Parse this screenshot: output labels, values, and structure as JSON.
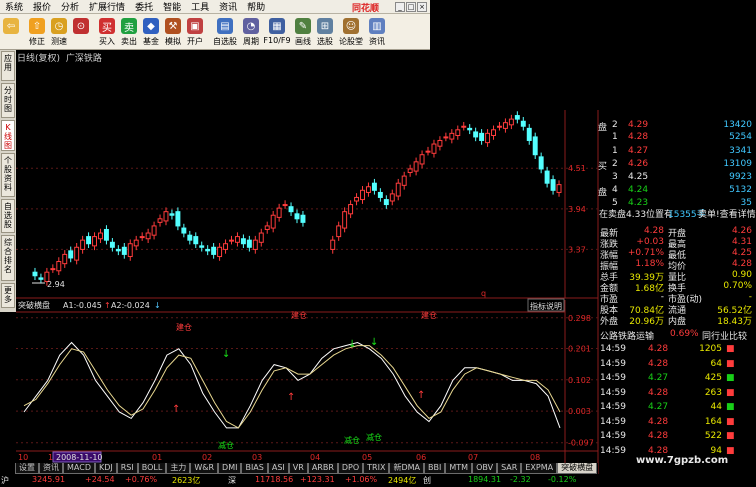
{
  "menubar": {
    "items": [
      "系统",
      "报价",
      "分析",
      "扩展行情",
      "委托",
      "智能",
      "工具",
      "资讯",
      "帮助"
    ],
    "brand": "同花顺"
  },
  "toolbar": {
    "buttons": [
      {
        "name": "back",
        "label": "",
        "icon": "back-arrow-icon",
        "color": "#e8b440"
      },
      {
        "name": "revise",
        "label": "修正",
        "icon": "up-arrow-icon",
        "color": "#f0a020"
      },
      {
        "name": "estimate",
        "label": "测速",
        "icon": "clock-icon",
        "color": "#d9a020"
      },
      {
        "name": "timer",
        "label": "",
        "icon": "timer-icon",
        "color": "#c03030"
      },
      {
        "name": "buy",
        "label": "买入",
        "icon": "buy-icon",
        "color": "#d03030"
      },
      {
        "name": "sell",
        "label": "卖出",
        "icon": "sell-icon",
        "color": "#20a040"
      },
      {
        "name": "fund",
        "label": "基金",
        "icon": "fund-icon",
        "color": "#3060c0"
      },
      {
        "name": "simulate",
        "label": "模拟",
        "icon": "hammer-icon",
        "color": "#b05020"
      },
      {
        "name": "open",
        "label": "开户",
        "icon": "door-icon",
        "color": "#c04040"
      },
      {
        "name": "self-select",
        "label": "自选股",
        "icon": "monitor-icon",
        "color": "#4070c0"
      },
      {
        "name": "period",
        "label": "周期",
        "icon": "period-icon",
        "color": "#6060a0"
      },
      {
        "name": "f10",
        "label": "F10/F9",
        "icon": "f10-icon",
        "color": "#4060a0"
      },
      {
        "name": "draw",
        "label": "画线",
        "icon": "pen-icon",
        "color": "#508040"
      },
      {
        "name": "pick",
        "label": "选股",
        "icon": "grid-icon",
        "color": "#6080a0"
      },
      {
        "name": "forum",
        "label": "论股堂",
        "icon": "people-icon",
        "color": "#a07030"
      },
      {
        "name": "news",
        "label": "资讯",
        "icon": "news-icon",
        "color": "#6080c0"
      }
    ]
  },
  "sidetabs": [
    "应用",
    "分时图",
    "K线图",
    "个股资料",
    "自选股",
    "综合排名",
    "更多"
  ],
  "stock": {
    "title": "日线(复权)",
    "name": "广深铁路",
    "low_label": "2.94",
    "q_mark": "q"
  },
  "price_axis": [
    "4.51",
    "3.94",
    "3.37"
  ],
  "indicator": {
    "name": "突破横盘",
    "a1_label": "A1:",
    "a1": "-0.045",
    "a2_label": "A2:",
    "a2": "-0.024",
    "button": "指标说明",
    "ticks": [
      "0.298",
      "0.201",
      "0.102",
      "0.003",
      "-0.097"
    ],
    "buy_labels": [
      "建仓",
      "建仓",
      "建仓"
    ],
    "sell_labels": [
      "减仓",
      "减仓",
      "减仓"
    ]
  },
  "x_axis": {
    "labels": [
      "10",
      "1",
      "01",
      "02",
      "03",
      "04",
      "05",
      "06",
      "07",
      "08"
    ],
    "date_box": "2008-11-10"
  },
  "quote": {
    "sell": [
      {
        "n": "2",
        "p": "4.29",
        "v": "13420"
      },
      {
        "n": "1",
        "p": "4.28",
        "v": "5254"
      }
    ],
    "buy": [
      {
        "n": "1",
        "p": "4.27",
        "v": "3341"
      },
      {
        "n": "2",
        "p": "4.26",
        "v": "13109"
      },
      {
        "n": "3",
        "p": "4.25",
        "v": "9923"
      },
      {
        "n": "4",
        "p": "4.24",
        "v": "5132"
      },
      {
        "n": "5",
        "p": "4.23",
        "v": "35"
      }
    ],
    "sell_side": "盘",
    "buy_side1": "买",
    "buy_side2": "盘",
    "info_line": "在卖盘4.33位置有",
    "info_line2": "15355手",
    "info_line3": "卖单!查看详情",
    "stats": [
      [
        "最新",
        "4.28",
        "开盘",
        "4.26"
      ],
      [
        "涨跌",
        "+0.03",
        "最高",
        "4.31"
      ],
      [
        "涨幅",
        "+0.71%",
        "最低",
        "4.25"
      ],
      [
        "振幅",
        "1.18%",
        "均价",
        "4.28"
      ],
      [
        "总手",
        "39.39万",
        "量比",
        "0.90"
      ],
      [
        "金额",
        "1.68亿",
        "换手",
        "0.70%"
      ],
      [
        "市盈",
        "-",
        "市盈(动)",
        "-"
      ],
      [
        "股本",
        "70.84亿",
        "流通",
        "56.52亿"
      ],
      [
        "外盘",
        "20.96万",
        "内盘",
        "18.43万"
      ]
    ],
    "sector": "公路铁路运输",
    "sector_pct": "0.69%",
    "compare": "同行业比较",
    "ticks": [
      [
        "14:59",
        "4.28",
        "1205",
        "up"
      ],
      [
        "14:59",
        "4.28",
        "64",
        "up"
      ],
      [
        "14:59",
        "4.27",
        "425",
        "down"
      ],
      [
        "14:59",
        "4.28",
        "263",
        "up"
      ],
      [
        "14:59",
        "4.27",
        "44",
        "down"
      ],
      [
        "14:59",
        "4.28",
        "164",
        "up"
      ],
      [
        "14:59",
        "4.28",
        "522",
        "up"
      ],
      [
        "14:59",
        "4.28",
        "94",
        "up"
      ]
    ]
  },
  "bottom_tabs": [
    "设置",
    "资讯",
    "MACD",
    "KDJ",
    "RSI",
    "BOLL",
    "主力",
    "W&R",
    "DMI",
    "BIAS",
    "ASI",
    "VR",
    "ARBR",
    "DPO",
    "TRIX",
    "新DMA",
    "BBI",
    "MTM",
    "OBV",
    "SAR",
    "EXPMA",
    "突破横盘"
  ],
  "status": {
    "index": "沪",
    "v1": "3245.91",
    "v2": "+24.54",
    "v3": "+0.76%",
    "v4": "2623亿",
    "v5": "深",
    "v6": "11718.56",
    "v7": "+123.31",
    "v8": "+1.06%",
    "v9": "2494亿",
    "v10": "创",
    "v11": "1894.31",
    "v12": "-2.32",
    "v13": "-0.12%"
  },
  "watermark": "www.7gpzb.com",
  "chart_data": {
    "type": "candlestick",
    "price_axis_ticks": [
      4.51,
      3.94,
      3.37
    ],
    "series_close": [
      3.0,
      2.95,
      3.05,
      3.1,
      3.2,
      3.3,
      3.25,
      3.4,
      3.5,
      3.45,
      3.55,
      3.6,
      3.5,
      3.4,
      3.35,
      3.3,
      3.45,
      3.5,
      3.55,
      3.6,
      3.7,
      3.8,
      3.9,
      3.85,
      3.7,
      3.6,
      3.5,
      3.45,
      3.4,
      3.35,
      3.3,
      3.4,
      3.45,
      3.5,
      3.55,
      3.45,
      3.4,
      3.5,
      3.6,
      3.7,
      3.85,
      3.95,
      4.0,
      3.9,
      3.8,
      3.75,
      3.6,
      3.5,
      3.45,
      3.4,
      3.5,
      3.7,
      3.9,
      4.0,
      4.1,
      4.2,
      4.25,
      4.2,
      4.1,
      4.0,
      4.15,
      4.3,
      4.4,
      4.5,
      4.6,
      4.7,
      4.75,
      4.85,
      4.9,
      4.95,
      5.0,
      5.05,
      5.1,
      5.05,
      4.95,
      4.9,
      5.0,
      5.05,
      5.1,
      5.15,
      5.2,
      5.2,
      5.1,
      4.9,
      4.7,
      4.5,
      4.3,
      4.2,
      4.28
    ],
    "indicator_a1": [
      0.0,
      0.05,
      0.1,
      0.18,
      0.22,
      0.18,
      0.1,
      0.05,
      0.0,
      -0.02,
      0.03,
      0.1,
      0.18,
      0.2,
      0.15,
      0.06,
      0.0,
      -0.05,
      -0.05,
      0.02,
      0.1,
      0.15,
      0.14,
      0.1,
      0.12,
      0.17,
      0.2,
      0.21,
      0.22,
      0.2,
      0.17,
      0.12,
      0.05,
      0.0,
      -0.03,
      0.02,
      0.1,
      0.14,
      0.14,
      0.13,
      0.12,
      0.1,
      0.1,
      0.09,
      0.05,
      -0.05
    ],
    "indicator_a2": [
      0.02,
      0.04,
      0.09,
      0.15,
      0.2,
      0.19,
      0.13,
      0.07,
      0.02,
      -0.01,
      0.01,
      0.07,
      0.14,
      0.18,
      0.17,
      0.1,
      0.03,
      -0.03,
      -0.05,
      0.0,
      0.07,
      0.13,
      0.14,
      0.12,
      0.12,
      0.15,
      0.18,
      0.2,
      0.21,
      0.21,
      0.18,
      0.14,
      0.08,
      0.02,
      -0.02,
      0.0,
      0.07,
      0.12,
      0.14,
      0.13,
      0.12,
      0.11,
      0.1,
      0.1,
      0.07,
      0.0
    ],
    "indicator_ticks": [
      0.298,
      0.201,
      0.102,
      0.003,
      -0.097
    ]
  }
}
